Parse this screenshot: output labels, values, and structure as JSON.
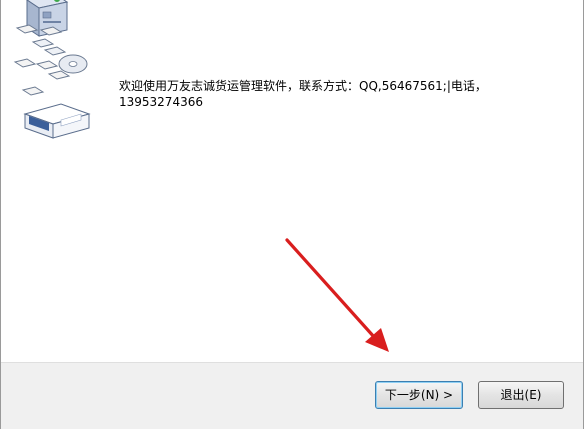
{
  "welcome": {
    "text": "欢迎使用万友志诚货运管理软件，联系方式：QQ,56467561;|电话，\n13953274366"
  },
  "buttons": {
    "next_label": "下一步(N) >",
    "exit_label": "退出(E)"
  },
  "colors": {
    "arrow": "#d91e1e",
    "button_bar": "#f0f0f0",
    "default_button_border": "#3c7fb1"
  },
  "icons": {
    "illustration": "computer-with-disks-icon",
    "annotation": "red-arrow-icon"
  }
}
